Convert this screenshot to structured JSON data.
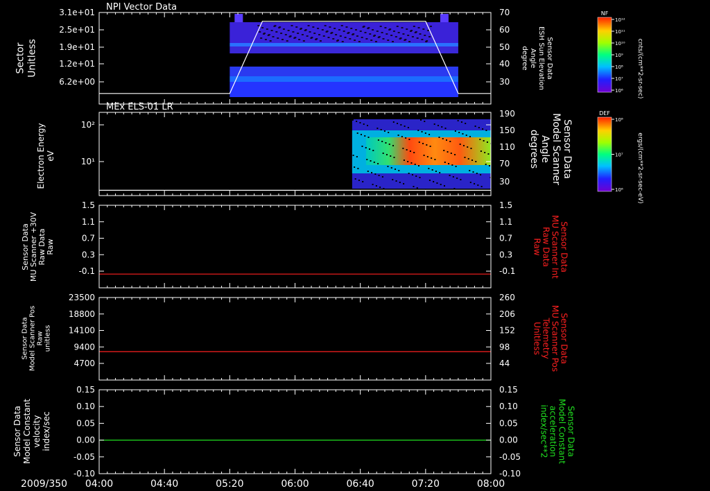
{
  "date_label": "2009/350",
  "x_ticks": [
    "04:00",
    "04:40",
    "05:20",
    "06:00",
    "06:40",
    "07:20",
    "08:00"
  ],
  "panels": [
    {
      "title": "NPI Vector Data",
      "left_label": [
        "Sector",
        "Unitless"
      ],
      "right_label": [
        "Sensor Data",
        "ESH Sun Elevation",
        "Angle",
        "degree"
      ],
      "left_ticks": [
        "3.1e+01",
        "2.5e+01",
        "1.9e+01",
        "1.2e+01",
        "6.2e+00"
      ],
      "right_ticks": [
        "70",
        "60",
        "50",
        "40",
        "30"
      ],
      "colorbar_label": "NF",
      "colorbar_ticks": [
        "10¹²",
        "10¹¹",
        "10¹⁰",
        "10⁹",
        "10⁸",
        "10⁷",
        "10⁶"
      ],
      "colorbar_units": "cnts/(cm**2-sr-sec)"
    },
    {
      "title": "MEx ELS-01 LR",
      "left_label": [
        "Electron Energy",
        "eV"
      ],
      "right_label": [
        "Sensor Data",
        "Model Scanner",
        "Angle",
        "degrees"
      ],
      "left_ticks": [
        "10²",
        "10¹"
      ],
      "right_ticks": [
        "190",
        "150",
        "110",
        "70",
        "30"
      ],
      "colorbar_label": "DEF",
      "colorbar_ticks": [
        "10⁸",
        "10⁷",
        "10⁶"
      ],
      "colorbar_units": "ergs/(cm**2-sr-sec-eV)"
    },
    {
      "left_label": [
        "Sensor Data",
        "MU Scanner +30V",
        "Raw Data",
        "Raw"
      ],
      "right_label": [
        "Sensor Data",
        "MU Scanner Int",
        "Raw Data",
        "Raw"
      ],
      "left_ticks": [
        "1.5",
        "1.1",
        "0.7",
        "0.3",
        "-0.1"
      ],
      "right_ticks": [
        "1.5",
        "1.1",
        "0.7",
        "0.3",
        "-0.1"
      ]
    },
    {
      "left_label": [
        "Sensor Data",
        "Model Scanner Pos",
        "Raw",
        "unitless"
      ],
      "right_label": [
        "Sensor Data",
        "MU Scanner Pos",
        "Telemetry",
        "Unitless"
      ],
      "left_ticks": [
        "23500",
        "18800",
        "14100",
        "9400",
        "4700"
      ],
      "right_ticks": [
        "260",
        "206",
        "152",
        "98",
        "44"
      ]
    },
    {
      "left_label": [
        "Sensor Data",
        "Model Constant",
        "velocity",
        "index/sec"
      ],
      "right_label": [
        "Sensor Data",
        "Model Constant",
        "acceleration",
        "index/sec**2"
      ],
      "left_ticks": [
        "0.15",
        "0.10",
        "0.05",
        "0.00",
        "-0.05",
        "-0.10"
      ],
      "right_ticks": [
        "0.15",
        "0.10",
        "0.05",
        "0.00",
        "-0.05",
        "-0.10"
      ]
    }
  ],
  "colors": {
    "red": "#ff2020",
    "green": "#20e020",
    "white": "#ffffff"
  },
  "chart_data": [
    {
      "type": "heatmap",
      "title": "NPI Vector Data",
      "xlabel": "2009/350",
      "ylabel": "Sector Unitless",
      "x_range": [
        "04:00",
        "08:00"
      ],
      "data_start": "05:20",
      "data_end": "07:40",
      "overlay_series": {
        "name": "Sensor Data ESH Sun Elevation Angle",
        "units": "degree",
        "x": [
          "04:00",
          "05:20",
          "05:40",
          "07:20",
          "07:40",
          "08:00"
        ],
        "y": [
          24,
          24,
          65,
          65,
          24,
          24
        ],
        "ylim": [
          18,
          70
        ]
      }
    },
    {
      "type": "heatmap",
      "title": "MEx ELS-01 LR",
      "ylabel": "Electron Energy eV",
      "yscale": "log",
      "x_range": [
        "04:00",
        "08:00"
      ],
      "data_start": "06:35",
      "data_end": "08:00",
      "overlay_series": {
        "name": "Sensor Data Model Scanner Angle",
        "units": "degrees",
        "x": [
          "04:00",
          "08:00"
        ],
        "y": [
          12,
          12
        ],
        "ylim": [
          0,
          190
        ]
      }
    },
    {
      "type": "line",
      "ylabel": "Sensor Data MU Scanner +30V Raw Data Raw",
      "ylim": [
        -0.3,
        1.5
      ],
      "series": [
        {
          "name": "Sensor Data MU Scanner Int Raw Data Raw",
          "color": "#ff2020",
          "x": [
            "04:00",
            "08:00"
          ],
          "y": [
            0,
            0
          ]
        }
      ]
    },
    {
      "type": "line",
      "ylabel": "Sensor Data Model Scanner Pos Raw unitless",
      "ylim": [
        0,
        23500
      ],
      "series": [
        {
          "name": "Sensor Data MU Scanner Pos Telemetry Unitless",
          "color": "#ff2020",
          "x": [
            "04:00",
            "08:00"
          ],
          "y": [
            8100,
            8100
          ]
        }
      ]
    },
    {
      "type": "line",
      "ylabel": "Sensor Data Model Constant velocity index/sec",
      "ylim": [
        -0.1,
        0.15
      ],
      "series": [
        {
          "name": "Sensor Data Model Constant acceleration index/sec**2",
          "color": "#20e020",
          "x": [
            "04:00",
            "08:00"
          ],
          "y": [
            0.0,
            0.0
          ]
        }
      ]
    }
  ]
}
